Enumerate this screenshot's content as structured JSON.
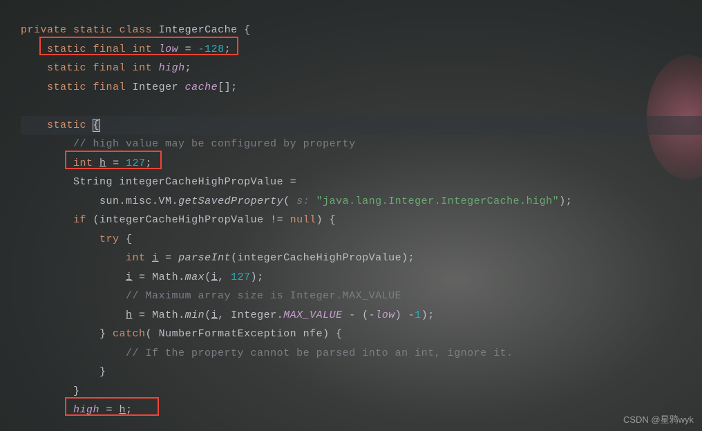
{
  "code": {
    "line1": {
      "kw1": "private",
      "kw2": "static",
      "kw3": "class",
      "cls": "IntegerCache",
      "brace": "{"
    },
    "line2": {
      "indent": "    ",
      "kw1": "static",
      "kw2": "final",
      "typ": "int",
      "var": "low",
      "eq": " = ",
      "num": "-128",
      "end": ";"
    },
    "line3": {
      "indent": "    ",
      "kw1": "static",
      "kw2": "final",
      "typ": "int",
      "var": "high",
      "end": ";"
    },
    "line4": {
      "indent": "    ",
      "kw1": "static",
      "kw2": "final",
      "typ": "Integer",
      "var": "cache",
      "bracket": "[]",
      "end": ";"
    },
    "line5": "",
    "line6": {
      "indent": "    ",
      "kw": "static",
      "brace": " {"
    },
    "line7": {
      "indent": "        ",
      "com": "// high value may be configured by property"
    },
    "line8": {
      "indent": "        ",
      "typ": "int",
      "var": "h",
      "eq": " = ",
      "num": "127",
      "end": ";"
    },
    "line9": {
      "indent": "        ",
      "typ": "String",
      "id": "integerCacheHighPropValue",
      "eq": " ="
    },
    "line10": {
      "indent": "            ",
      "qual": "sun.misc.VM.",
      "fn": "getSavedProperty",
      "open": "( ",
      "hint": "s: ",
      "str": "\"java.lang.Integer.IntegerCache.high\"",
      "close": ");"
    },
    "line11": {
      "indent": "        ",
      "kw": "if",
      "open": " (",
      "id": "integerCacheHighPropValue",
      "op": " != ",
      "null": "null",
      "close": ") {"
    },
    "line12": {
      "indent": "            ",
      "kw": "try",
      "brace": " {"
    },
    "line13": {
      "indent": "                ",
      "typ": "int",
      "var": "i",
      "eq": " = ",
      "fn": "parseInt",
      "open": "(",
      "id": "integerCacheHighPropValue",
      "close": ");"
    },
    "line14": {
      "indent": "                ",
      "var": "i",
      "eq": " = ",
      "qual": "Math.",
      "fn": "max",
      "open": "(",
      "arg1": "i",
      "comma": ", ",
      "num": "127",
      "close": ");"
    },
    "line15": {
      "indent": "                ",
      "com": "// Maximum array size is Integer.MAX_VALUE"
    },
    "line16": {
      "indent": "                ",
      "var": "h",
      "eq": " = ",
      "qual": "Math.",
      "fn": "min",
      "open": "(",
      "arg1": "i",
      "comma": ", ",
      "qual2": "Integer.",
      "const": "MAX_VALUE",
      "op": " - (-",
      "var2": "low",
      "close": ") -",
      "num": "1",
      "end": ");"
    },
    "line17": {
      "indent": "            ",
      "brace1": "} ",
      "kw": "catch",
      "open": "( ",
      "typ": "NumberFormatException",
      "id": " nfe",
      "close": ") {"
    },
    "line18": {
      "indent": "                ",
      "com": "// If the property cannot be parsed into an int, ignore it."
    },
    "line19": {
      "indent": "            ",
      "brace": "}"
    },
    "line20": {
      "indent": "        ",
      "brace": "}"
    },
    "line21": {
      "indent": "        ",
      "var": "high",
      "eq": " = ",
      "var2": "h",
      "end": ";"
    }
  },
  "watermark": "CSDN @星鸦wyk"
}
